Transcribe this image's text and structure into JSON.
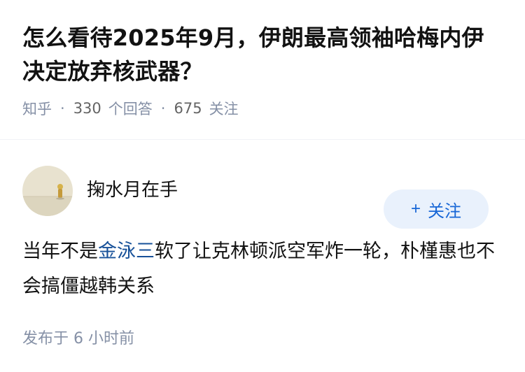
{
  "question": {
    "title": "怎么看待2025年9月，伊朗最高领袖哈梅内伊决定放弃核武器？",
    "source": "知乎",
    "answers_count": "330",
    "answers_label": "个回答",
    "followers_count": "675",
    "followers_label": "关注"
  },
  "answer": {
    "author_name": "掬水月在手",
    "follow_label": "关注",
    "follow_icon": "plus-icon",
    "content_before": "当年不是",
    "content_link": "金泳三",
    "content_after": "软了让克林顿派空军炸一轮，朴槿惠也不会搞僵越韩关系",
    "time_label": "发布于",
    "time_value": "6 小时前"
  },
  "colors": {
    "accent": "#1766d6",
    "follow_bg": "#e9f1fc",
    "meta_gray": "#8590a6",
    "link": "#175199"
  }
}
